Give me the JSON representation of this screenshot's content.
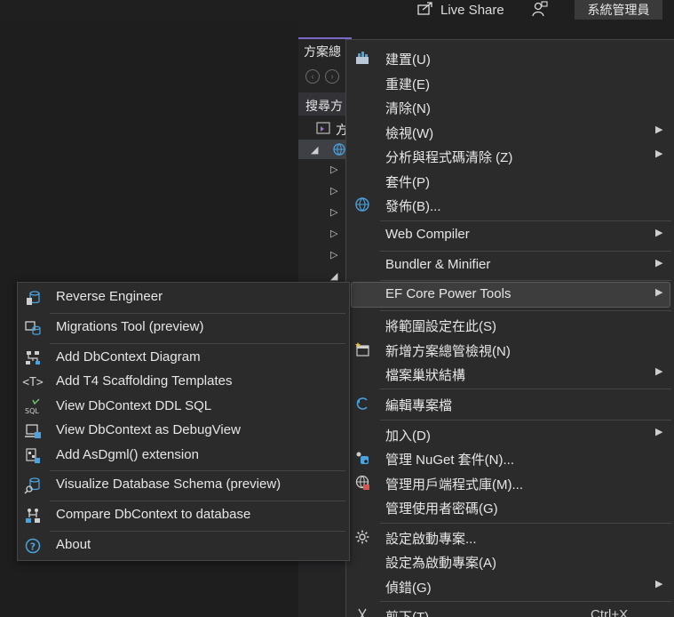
{
  "topbar": {
    "live_share_label": "Live Share",
    "admin_label": "系統管理員"
  },
  "panel": {
    "title": "方案總",
    "search_label": "搜尋方",
    "project_item_label": "方"
  },
  "context_menu": {
    "items": [
      {
        "label": "建置(U)",
        "icon": "build-icon"
      },
      {
        "label": "重建(E)"
      },
      {
        "label": "清除(N)"
      },
      {
        "label": "檢視(W)",
        "submenu": true
      },
      {
        "label": "分析與程式碼清除 (Z)",
        "submenu": true
      },
      {
        "label": "套件(P)"
      },
      {
        "label": "發佈(B)...",
        "icon": "publish-globe-icon"
      },
      {
        "label": "Web Compiler",
        "submenu": true
      },
      {
        "label": "Bundler & Minifier",
        "submenu": true
      },
      {
        "label": "EF Core Power Tools",
        "submenu": true,
        "highlighted": true
      },
      {
        "label": "將範圍設定在此(S)"
      },
      {
        "label": "新增方案總管檢視(N)",
        "icon": "new-explorer-view-icon"
      },
      {
        "label": "檔案巢狀結構",
        "submenu": true
      },
      {
        "label": "編輯專案檔",
        "icon": "edit-project-icon"
      },
      {
        "label": "加入(D)",
        "submenu": true
      },
      {
        "label": "管理 NuGet 套件(N)...",
        "icon": "nuget-icon"
      },
      {
        "label": "管理用戶端程式庫(M)...",
        "icon": "client-library-icon"
      },
      {
        "label": "管理使用者密碼(G)"
      },
      {
        "label": "設定啟動專案...",
        "icon": "gear-icon"
      },
      {
        "label": "設定為啟動專案(A)"
      },
      {
        "label": "偵錯(G)",
        "submenu": true
      },
      {
        "label": "剪下(T)",
        "icon": "cut-icon",
        "shortcut": "Ctrl+X"
      }
    ]
  },
  "ef_submenu": {
    "items": [
      {
        "label": "Reverse Engineer",
        "icon": "reverse-engineer-icon"
      },
      {
        "label": "Migrations Tool (preview)",
        "icon": "migrations-icon"
      },
      {
        "label": "Add DbContext Diagram",
        "icon": "diagram-icon"
      },
      {
        "label": "Add T4 Scaffolding Templates",
        "icon": "t4-template-icon"
      },
      {
        "label": "View DbContext DDL SQL",
        "icon": "sql-icon"
      },
      {
        "label": "View DbContext as DebugView",
        "icon": "debugview-icon"
      },
      {
        "label": "Add AsDgml() extension",
        "icon": "dgml-extension-icon"
      },
      {
        "label": "Visualize Database Schema (preview)",
        "icon": "visualize-schema-icon"
      },
      {
        "label": "Compare DbContext to database",
        "icon": "compare-icon"
      },
      {
        "label": "About",
        "icon": "about-icon"
      }
    ]
  },
  "colors": {
    "accent": "#7b68c9",
    "menu_bg": "#2b2b2b",
    "highlight_bg": "#3d3d3d",
    "icon_blue": "#4aa3df"
  }
}
